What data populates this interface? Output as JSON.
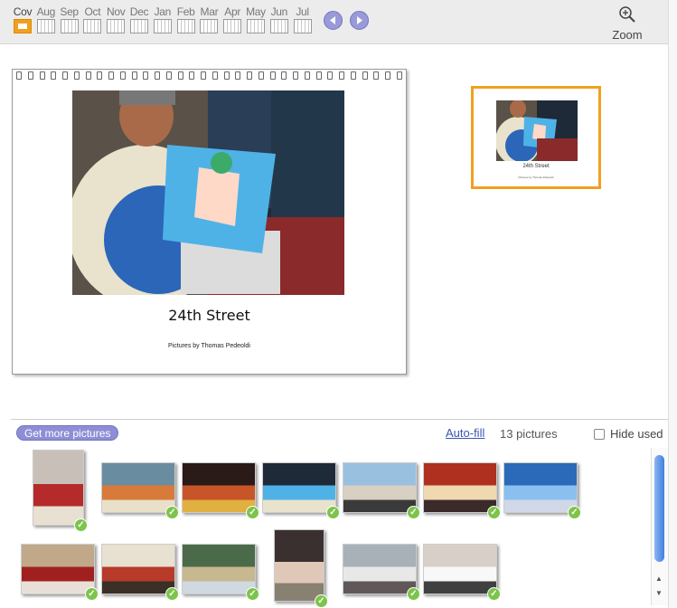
{
  "toolbar": {
    "months": [
      "Cov",
      "Aug",
      "Sep",
      "Oct",
      "Nov",
      "Dec",
      "Jan",
      "Feb",
      "Mar",
      "Apr",
      "May",
      "Jun",
      "Jul"
    ],
    "selected_month": "Cov",
    "zoom_label": "Zoom"
  },
  "page": {
    "title": "24th Street",
    "subtitle": "Pictures by Thomas Pedeoldi"
  },
  "preview": {
    "title": "24th Street",
    "subtitle": "Pictures by Thomas Pedeoldi"
  },
  "bar": {
    "more_pictures_label": "Get more pictures",
    "autofill_label": "Auto-fill",
    "count_label": "13 pictures",
    "hide_used_label": "Hide used",
    "hide_used_checked": false
  },
  "tray": {
    "pictures": [
      {
        "subject": "storefront-with-sign",
        "used": true
      },
      {
        "subject": "mural-wall",
        "used": true
      },
      {
        "subject": "colorful-mural",
        "used": true
      },
      {
        "subject": "man-holding-painting",
        "used": true
      },
      {
        "subject": "street-walkers",
        "used": true
      },
      {
        "subject": "red-storefront",
        "used": true
      },
      {
        "subject": "blue-mural",
        "used": true
      },
      {
        "subject": "group-on-sidewalk",
        "used": true
      },
      {
        "subject": "shop-front",
        "used": true
      },
      {
        "subject": "mural-street",
        "used": true
      },
      {
        "subject": "portrait-man",
        "used": true
      },
      {
        "subject": "elderly-woman",
        "used": true
      },
      {
        "subject": "white-wall-walker",
        "used": true
      }
    ]
  },
  "colors": {
    "accent_orange": "#f0a020",
    "button_purple": "#8e8ed6",
    "check_green": "#7cc44a",
    "link_blue": "#3a55b0"
  }
}
